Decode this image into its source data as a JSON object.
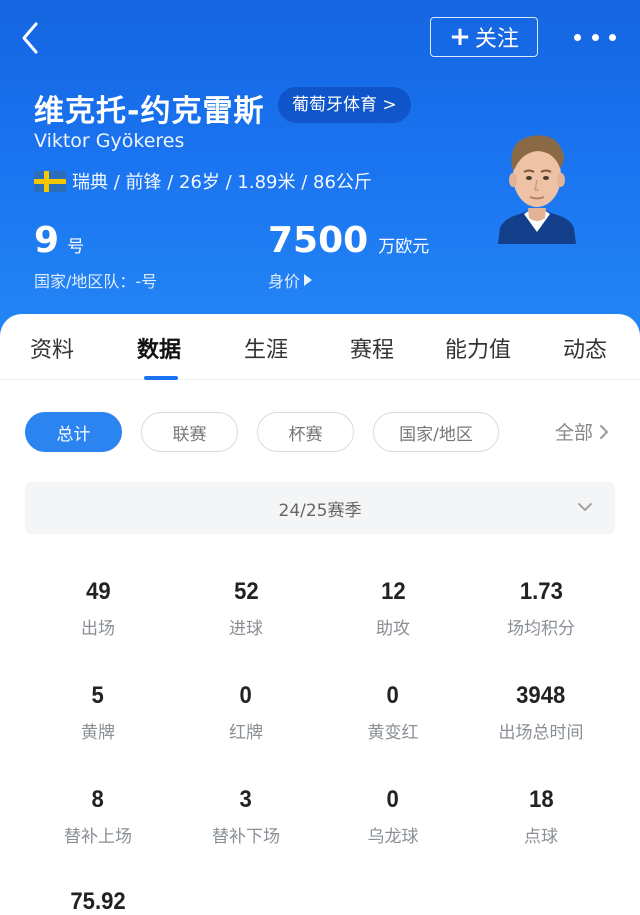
{
  "header": {
    "follow_label": "关注",
    "name_cn": "维克托-约克雷斯",
    "club_link": "葡萄牙体育 >",
    "name_en": "Viktor Gyökeres",
    "meta": "瑞典 / 前锋 / 26岁 / 1.89米 / 86公斤",
    "shirt_number": "9",
    "shirt_unit": "号",
    "national_team": "国家/地区队：-号",
    "market_value": "7500",
    "market_value_unit": "万欧元",
    "market_value_label": "身价"
  },
  "tabs": [
    "资料",
    "数据",
    "生涯",
    "赛程",
    "能力值",
    "动态"
  ],
  "active_tab": "数据",
  "filters": {
    "chips": [
      "总计",
      "联赛",
      "杯赛",
      "国家/地区"
    ],
    "active": "总计",
    "all_label": "全部"
  },
  "season": "24/25赛季",
  "stats": [
    {
      "value": "49",
      "label": "出场"
    },
    {
      "value": "52",
      "label": "进球"
    },
    {
      "value": "12",
      "label": "助攻"
    },
    {
      "value": "1.73",
      "label": "场均积分"
    },
    {
      "value": "5",
      "label": "黄牌"
    },
    {
      "value": "0",
      "label": "红牌"
    },
    {
      "value": "0",
      "label": "黄变红"
    },
    {
      "value": "3948",
      "label": "出场总时间"
    },
    {
      "value": "8",
      "label": "替补上场"
    },
    {
      "value": "3",
      "label": "替补下场"
    },
    {
      "value": "0",
      "label": "乌龙球"
    },
    {
      "value": "18",
      "label": "点球"
    },
    {
      "value": "75.92",
      "label": ""
    }
  ],
  "colors": {
    "header_blue": "#1a73f0",
    "active_chip": "#2b84f0"
  },
  "icons": [
    "back-icon",
    "plus-icon",
    "more-icon",
    "sweden-flag-icon",
    "play-triangle-icon",
    "chevron-right-icon",
    "chevron-down-icon"
  ]
}
